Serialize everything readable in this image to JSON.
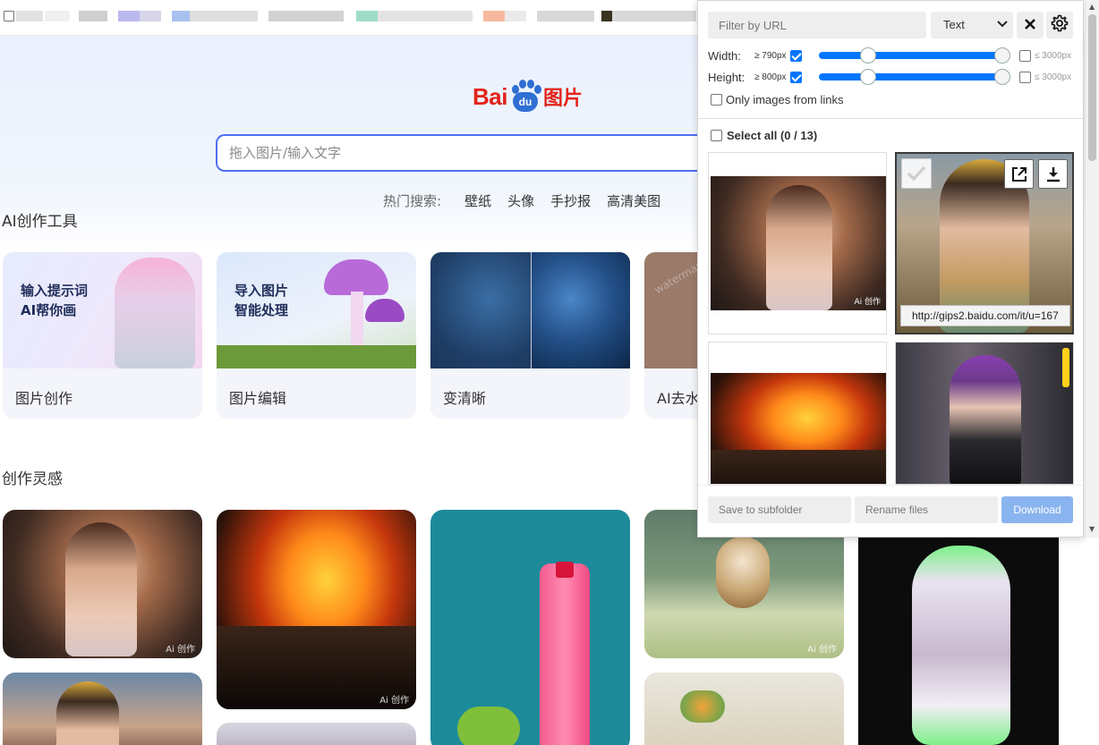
{
  "baidu": {
    "logo_bai": "Bai",
    "logo_du": "du",
    "logo_tupian": "图片",
    "search_placeholder": "拖入图片/输入文字",
    "hot_label": "热门搜索:",
    "hot_links": [
      "壁纸",
      "头像",
      "手抄报",
      "高清美图"
    ],
    "section_tools": "AI创作工具",
    "section_inspiration": "创作灵感",
    "tools": [
      {
        "label": "图片创作",
        "art_text_1": "输入提示词",
        "art_text_2": "AI帮你画"
      },
      {
        "label": "图片编辑",
        "art_text_1": "导入图片",
        "art_text_2": "智能处理"
      },
      {
        "label": "变清晰"
      },
      {
        "label": "AI去水",
        "art_text_1": "watermark"
      }
    ],
    "ai_watermark": "Ai 创作"
  },
  "extension": {
    "filter_placeholder": "Filter by URL",
    "mode": "Text",
    "width_label": "Width:",
    "width_min": "≥ 790px",
    "width_max": "≤ 3000px",
    "height_label": "Height:",
    "height_min": "≥ 800px",
    "height_max": "≤ 3000px",
    "only_links_label": "Only images from links",
    "select_all_label": "Select all (0 / 13)",
    "tooltip_url": "http://gips2.baidu.com/it/u=167",
    "subfolder_placeholder": "Save to subfolder",
    "rename_placeholder": "Rename files",
    "download_label": "Download"
  }
}
